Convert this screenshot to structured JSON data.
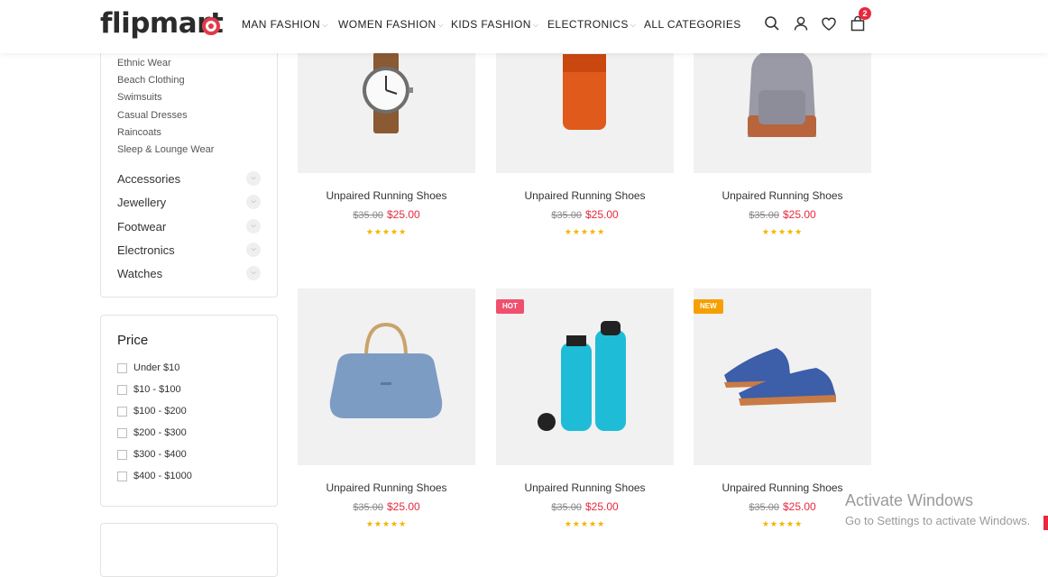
{
  "header": {
    "logo": "flipmart",
    "nav": [
      {
        "label": "MAN FASHION",
        "has_dropdown": true
      },
      {
        "label": "WOMEN FASHION",
        "has_dropdown": true
      },
      {
        "label": "KIDS FASHION",
        "has_dropdown": true
      },
      {
        "label": "ELECTRONICS",
        "has_dropdown": true
      },
      {
        "label": "ALL CATEGORIES",
        "has_dropdown": false
      }
    ],
    "icons": [
      "search-icon",
      "user-icon",
      "heart-icon",
      "cart-icon"
    ],
    "cart_count": "2"
  },
  "sidebar": {
    "subcategories": [
      "Ethnic Wear",
      "Beach Clothing",
      "Swimsuits",
      "Casual Dresses",
      "Raincoats",
      "Sleep & Lounge Wear"
    ],
    "categories": [
      "Accessories",
      "Jewellery",
      "Footwear",
      "Electronics",
      "Watches"
    ],
    "price": {
      "title": "Price",
      "options": [
        "Under $10",
        "$10 - $100",
        "$100 - $200",
        "$200 - $300",
        "$300 - $400",
        "$400 - $1000"
      ]
    }
  },
  "products": [
    {
      "name": "Unpaired Running Shoes",
      "old_price": "$35.00",
      "price": "$25.00",
      "rating": 5,
      "image": "watch",
      "badge": ""
    },
    {
      "name": "Unpaired Running Shoes",
      "old_price": "$35.00",
      "price": "$25.00",
      "rating": 5,
      "image": "orange-case",
      "badge": ""
    },
    {
      "name": "Unpaired Running Shoes",
      "old_price": "$35.00",
      "price": "$25.00",
      "rating": 5,
      "image": "backpack",
      "badge": ""
    },
    {
      "name": "Unpaired Running Shoes",
      "old_price": "$35.00",
      "price": "$25.00",
      "rating": 5,
      "image": "handbag",
      "badge": ""
    },
    {
      "name": "Unpaired Running Shoes",
      "old_price": "$35.00",
      "price": "$25.00",
      "rating": 5,
      "image": "bottles",
      "badge": "HOT"
    },
    {
      "name": "Unpaired Running Shoes",
      "old_price": "$35.00",
      "price": "$25.00",
      "rating": 5,
      "image": "shoes",
      "badge": "NEW"
    }
  ],
  "badge_colors": {
    "HOT": "#f0506e",
    "NEW": "#f5a000"
  },
  "accent_color": "#e8283e",
  "os_watermark": {
    "title": "Activate Windows",
    "subtitle": "Go to Settings to activate Windows."
  }
}
